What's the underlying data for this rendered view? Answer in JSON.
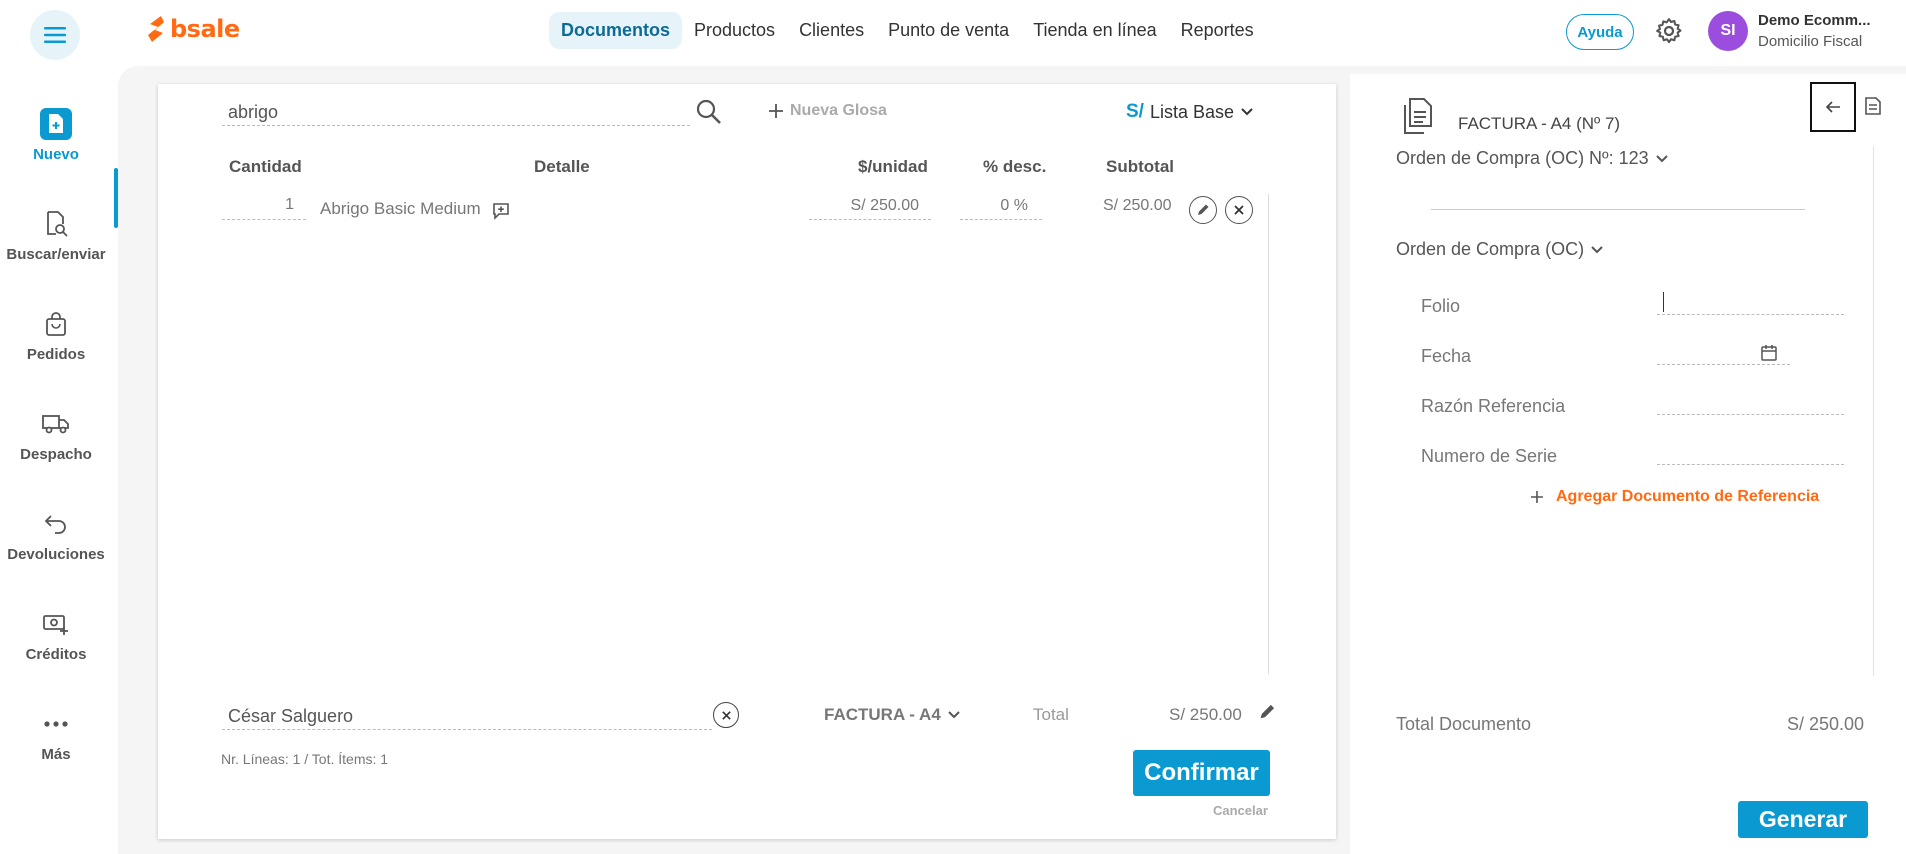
{
  "brand": {
    "name": "bsale",
    "accent": "#ff6a13",
    "primary": "#0a9ad1"
  },
  "topnav": {
    "items": [
      {
        "label": "Documentos"
      },
      {
        "label": "Productos"
      },
      {
        "label": "Clientes"
      },
      {
        "label": "Punto de venta"
      },
      {
        "label": "Tienda en línea"
      },
      {
        "label": "Reportes"
      }
    ],
    "active": "Documentos",
    "help_label": "Ayuda",
    "avatar_initials": "SI",
    "account_name": "Demo Ecomm...",
    "account_sub": "Domicilio Fiscal"
  },
  "sidebar": {
    "items": [
      {
        "label": "Nuevo",
        "icon": "new-document-icon"
      },
      {
        "label": "Buscar/enviar",
        "icon": "search-document-icon"
      },
      {
        "label": "Pedidos",
        "icon": "shopping-bag-icon"
      },
      {
        "label": "Despacho",
        "icon": "truck-icon"
      },
      {
        "label": "Devoluciones",
        "icon": "return-arrow-icon"
      },
      {
        "label": "Créditos",
        "icon": "cash-plus-icon"
      },
      {
        "label": "Más",
        "icon": "more-dots-icon"
      }
    ],
    "active": "Nuevo"
  },
  "editor": {
    "search_value": "abrigo",
    "new_gloss_label": "Nueva Glosa",
    "currency_symbol": "S/",
    "price_list": "Lista Base",
    "columns": {
      "cantidad": "Cantidad",
      "detalle": "Detalle",
      "unidad": "$/unidad",
      "desc": "% desc.",
      "subtotal": "Subtotal"
    },
    "rows": [
      {
        "cantidad": "1",
        "detalle": "Abrigo Basic Medium",
        "unidad": "S/ 250.00",
        "desc": "0 %",
        "subtotal": "S/ 250.00"
      }
    ],
    "client": "César Salguero",
    "doc_type": "FACTURA - A4",
    "total_label": "Total",
    "total_value": "S/ 250.00",
    "summary": "Nr. Líneas: 1 / Tot. Ítems: 1",
    "confirm_label": "Confirmar",
    "cancel_label": "Cancelar"
  },
  "panel": {
    "doc_title": "FACTURA - A4 (Nº 7)",
    "oc_summary": "Orden de Compra (OC) Nº: 123",
    "oc_section": "Orden de Compra (OC)",
    "fields": [
      {
        "label": "Folio",
        "value": ""
      },
      {
        "label": "Fecha",
        "value": ""
      },
      {
        "label": "Razón Referencia",
        "value": ""
      },
      {
        "label": "Numero de Serie",
        "value": ""
      }
    ],
    "add_reference_label": "Agregar Documento de Referencia",
    "total_doc_label": "Total Documento",
    "total_doc_value": "S/ 250.00",
    "generate_label": "Generar"
  }
}
